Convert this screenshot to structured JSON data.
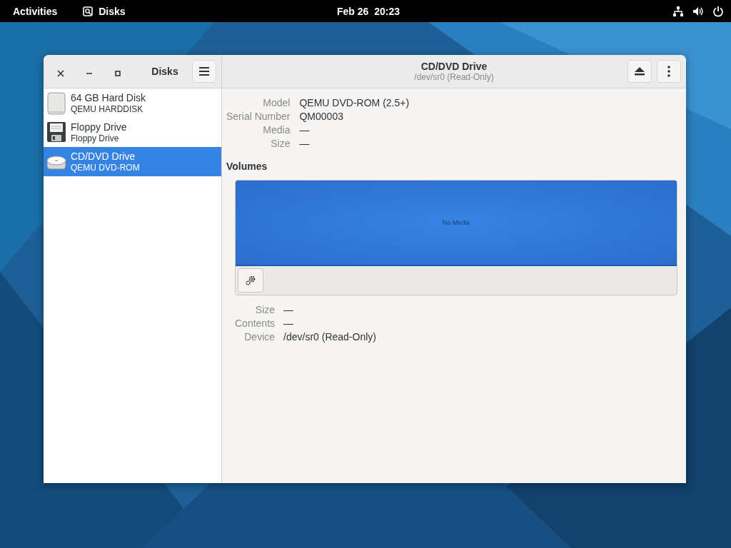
{
  "top_bar": {
    "activities": "Activities",
    "app_name": "Disks",
    "clock": "Feb 26  20:23"
  },
  "sidebar": {
    "title": "Disks",
    "drives": [
      {
        "kind": "hdd",
        "name": "64 GB Hard Disk",
        "subtitle": "QEMU HARDDISK",
        "selected": false
      },
      {
        "kind": "floppy",
        "name": "Floppy Drive",
        "subtitle": "Floppy Drive",
        "selected": false
      },
      {
        "kind": "optical",
        "name": "CD/DVD Drive",
        "subtitle": "QEMU DVD-ROM",
        "selected": true
      }
    ]
  },
  "header": {
    "title": "CD/DVD Drive",
    "subtitle": "/dev/sr0 (Read-Only)"
  },
  "details": [
    {
      "label": "Model",
      "value": "QEMU DVD-ROM (2.5+)"
    },
    {
      "label": "Serial Number",
      "value": "QM00003"
    },
    {
      "label": "Media",
      "value": "—"
    },
    {
      "label": "Size",
      "value": "—"
    }
  ],
  "volumes": {
    "heading": "Volumes",
    "map_label": "No Media",
    "properties": [
      {
        "label": "Size",
        "value": "—"
      },
      {
        "label": "Contents",
        "value": "—"
      },
      {
        "label": "Device",
        "value": "/dev/sr0 (Read-Only)"
      }
    ]
  }
}
